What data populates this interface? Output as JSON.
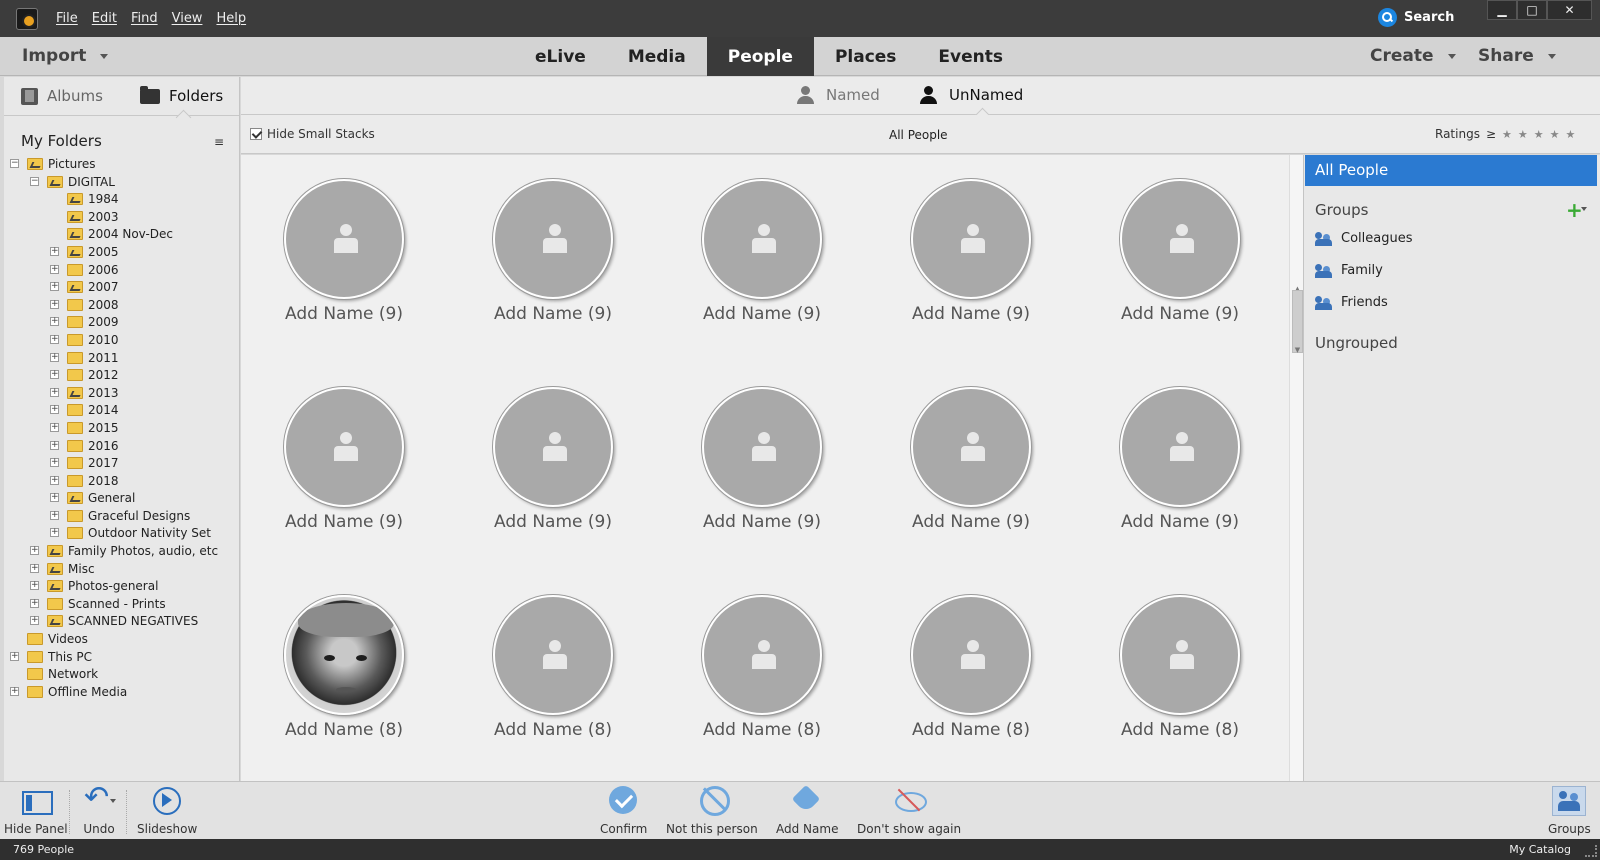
{
  "window": {
    "menu": [
      "File",
      "Edit",
      "Find",
      "View",
      "Help"
    ],
    "search_label": "Search",
    "controls": {
      "minimize": "▁",
      "maximize": "□",
      "close": "✕"
    }
  },
  "nav": {
    "import_label": "Import",
    "tabs": [
      "eLive",
      "Media",
      "People",
      "Places",
      "Events"
    ],
    "active_tab": "People",
    "create_label": "Create",
    "share_label": "Share"
  },
  "left_panel": {
    "albums_label": "Albums",
    "folders_label": "Folders",
    "header": "My Folders",
    "options_icon": "≡",
    "tree": [
      {
        "label": "Pictures",
        "depth": 0,
        "expander": "−",
        "icon": "folder-image"
      },
      {
        "label": "DIGITAL",
        "depth": 1,
        "expander": "−",
        "icon": "folder-image"
      },
      {
        "label": "1984",
        "depth": 2,
        "expander": "",
        "icon": "folder-image"
      },
      {
        "label": "2003",
        "depth": 2,
        "expander": "",
        "icon": "folder-image"
      },
      {
        "label": "2004 Nov-Dec",
        "depth": 2,
        "expander": "",
        "icon": "folder-image"
      },
      {
        "label": "2005",
        "depth": 2,
        "expander": "+",
        "icon": "folder-image"
      },
      {
        "label": "2006",
        "depth": 2,
        "expander": "+",
        "icon": "folder"
      },
      {
        "label": "2007",
        "depth": 2,
        "expander": "+",
        "icon": "folder-image"
      },
      {
        "label": "2008",
        "depth": 2,
        "expander": "+",
        "icon": "folder"
      },
      {
        "label": "2009",
        "depth": 2,
        "expander": "+",
        "icon": "folder"
      },
      {
        "label": "2010",
        "depth": 2,
        "expander": "+",
        "icon": "folder"
      },
      {
        "label": "2011",
        "depth": 2,
        "expander": "+",
        "icon": "folder"
      },
      {
        "label": "2012",
        "depth": 2,
        "expander": "+",
        "icon": "folder"
      },
      {
        "label": "2013",
        "depth": 2,
        "expander": "+",
        "icon": "folder-image"
      },
      {
        "label": "2014",
        "depth": 2,
        "expander": "+",
        "icon": "folder"
      },
      {
        "label": "2015",
        "depth": 2,
        "expander": "+",
        "icon": "folder"
      },
      {
        "label": "2016",
        "depth": 2,
        "expander": "+",
        "icon": "folder"
      },
      {
        "label": "2017",
        "depth": 2,
        "expander": "+",
        "icon": "folder"
      },
      {
        "label": "2018",
        "depth": 2,
        "expander": "+",
        "icon": "folder"
      },
      {
        "label": "General",
        "depth": 2,
        "expander": "+",
        "icon": "folder-image"
      },
      {
        "label": "Graceful Designs",
        "depth": 2,
        "expander": "+",
        "icon": "folder"
      },
      {
        "label": "Outdoor Nativity Set",
        "depth": 2,
        "expander": "+",
        "icon": "folder"
      },
      {
        "label": "Family Photos, audio, etc",
        "depth": 1,
        "expander": "+",
        "icon": "folder-image"
      },
      {
        "label": "Misc",
        "depth": 1,
        "expander": "+",
        "icon": "folder-image"
      },
      {
        "label": "Photos-general",
        "depth": 1,
        "expander": "+",
        "icon": "folder-image"
      },
      {
        "label": "Scanned - Prints",
        "depth": 1,
        "expander": "+",
        "icon": "folder"
      },
      {
        "label": "SCANNED NEGATIVES",
        "depth": 1,
        "expander": "+",
        "icon": "folder-image"
      },
      {
        "label": "Videos",
        "depth": 0,
        "expander": "",
        "icon": "folder"
      },
      {
        "label": "This PC",
        "depth": 0,
        "expander": "+",
        "icon": "folder"
      },
      {
        "label": "Network",
        "depth": 0,
        "expander": "",
        "icon": "folder"
      },
      {
        "label": "Offline Media",
        "depth": 0,
        "expander": "+",
        "icon": "folder"
      }
    ]
  },
  "subtabs": {
    "named_label": "Named",
    "unnamed_label": "UnNamed",
    "active": "UnNamed"
  },
  "filter": {
    "hide_small_label": "Hide Small Stacks",
    "hide_small_checked": true,
    "view_label": "All People",
    "ratings_label": "Ratings",
    "ratings_op": "≥",
    "stars": 5
  },
  "people": [
    {
      "name": "Add Name (9)",
      "photo": false
    },
    {
      "name": "Add Name (9)",
      "photo": false
    },
    {
      "name": "Add Name (9)",
      "photo": false
    },
    {
      "name": "Add Name (9)",
      "photo": false
    },
    {
      "name": "Add Name (9)",
      "photo": false
    },
    {
      "name": "Add Name (9)",
      "photo": false
    },
    {
      "name": "Add Name (9)",
      "photo": false
    },
    {
      "name": "Add Name (9)",
      "photo": false
    },
    {
      "name": "Add Name (9)",
      "photo": false
    },
    {
      "name": "Add Name (9)",
      "photo": false
    },
    {
      "name": "Add Name (8)",
      "photo": true
    },
    {
      "name": "Add Name (8)",
      "photo": false
    },
    {
      "name": "Add Name (8)",
      "photo": false
    },
    {
      "name": "Add Name (8)",
      "photo": false
    },
    {
      "name": "Add Name (8)",
      "photo": false
    }
  ],
  "right_panel": {
    "all_people_label": "All People",
    "groups_label": "Groups",
    "add_group_icon": "+",
    "groups": [
      "Colleagues",
      "Family",
      "Friends"
    ],
    "ungrouped_label": "Ungrouped",
    "accent": "#2b7ad1"
  },
  "bottom_tools": {
    "hide_panel": "Hide Panel",
    "undo": "Undo",
    "slideshow": "Slideshow",
    "confirm": "Confirm",
    "not_this_person": "Not this person",
    "add_name": "Add Name",
    "dont_show": "Don't show again",
    "groups": "Groups"
  },
  "status": {
    "count": "769 People",
    "catalog": "My Catalog"
  }
}
